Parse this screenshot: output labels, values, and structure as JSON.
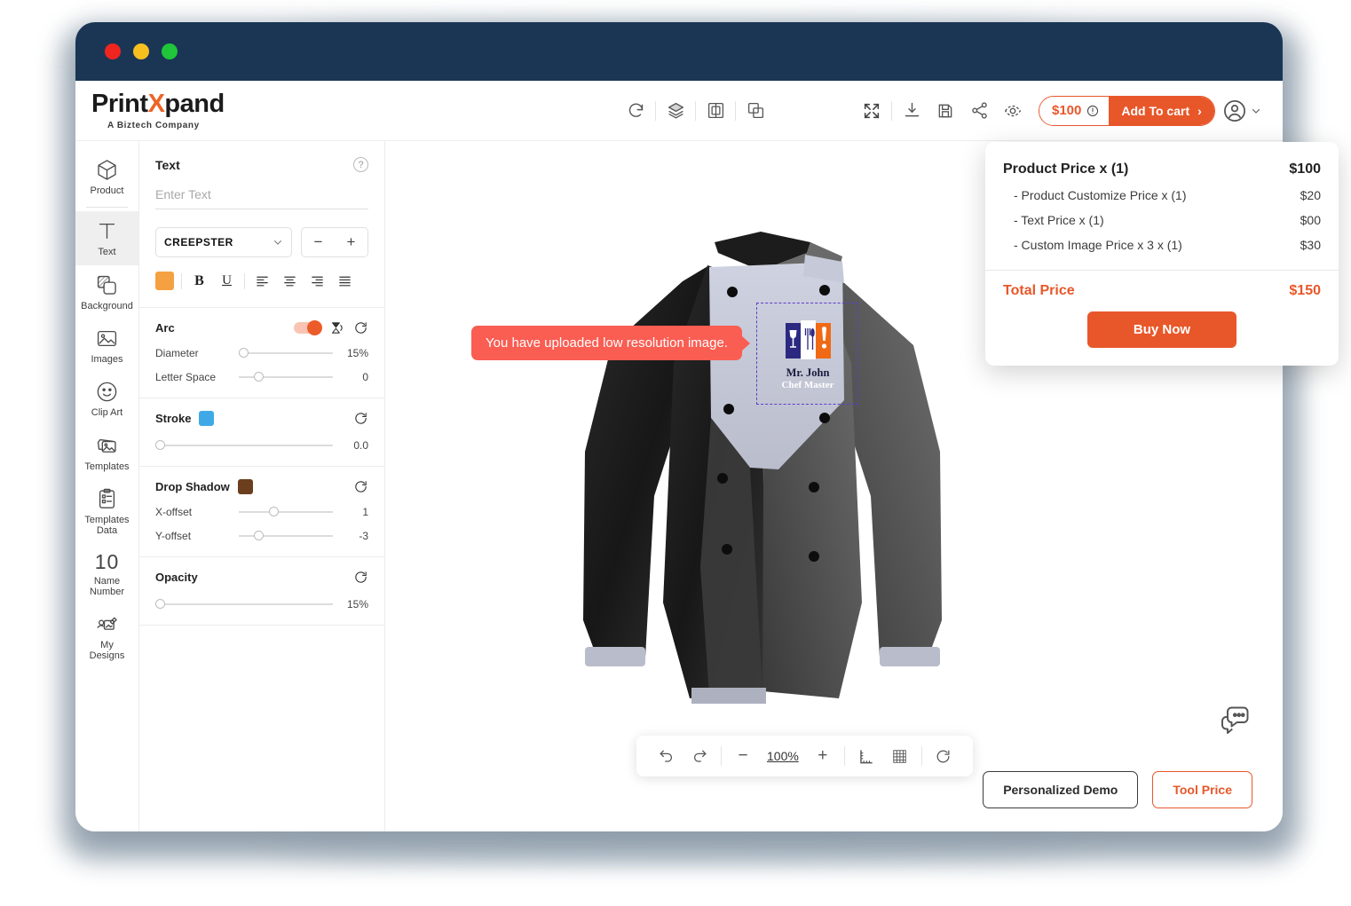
{
  "window": {
    "traffic_lights": [
      "close",
      "minimize",
      "maximize"
    ]
  },
  "brand": {
    "name_part1": "Print",
    "name_x": "X",
    "name_part2": "pand",
    "tagline": "A Biztech Company"
  },
  "toolbar": {
    "center_icons": [
      "reset-history-icon",
      "layers-icon",
      "align-objects-icon",
      "duplicate-icon"
    ],
    "right_icons": [
      "fullscreen-icon",
      "download-icon",
      "save-icon",
      "share-icon",
      "preview-eye-icon",
      "3d-view-icon"
    ],
    "price_label": "$100",
    "price_info_icon": "info-icon",
    "add_to_cart_label": "Add To cart",
    "add_to_cart_chevron": "›",
    "account_icon": "user-avatar-icon",
    "account_chevron": "chevron-down-icon"
  },
  "sidebar": {
    "items": [
      {
        "label": "Product",
        "icon": "cube-icon",
        "active": false
      },
      {
        "label": "Text",
        "icon": "text-t-icon",
        "active": true
      },
      {
        "label": "Background",
        "icon": "background-layers-icon",
        "active": false
      },
      {
        "label": "Images",
        "icon": "image-icon",
        "active": false
      },
      {
        "label": "Clip Art",
        "icon": "smiley-icon",
        "active": false
      },
      {
        "label": "Templates",
        "icon": "templates-icon",
        "active": false
      },
      {
        "label": "Templates Data",
        "label_line1": "Templates",
        "label_line2": "Data",
        "icon": "clipboard-list-icon",
        "active": false
      },
      {
        "label": "Name Number",
        "label_line1": "Name",
        "label_line2": "Number",
        "icon": "number-10-icon",
        "icon_text": "10",
        "active": false
      },
      {
        "label": "My Designs",
        "label_line1": "My",
        "label_line2": "Designs",
        "icon": "my-designs-icon",
        "active": false
      }
    ]
  },
  "panel": {
    "title": "Text",
    "help_icon": "help-question-icon",
    "text_input_placeholder": "Enter Text",
    "text_input_value": "",
    "font_name": "CREEPSTER",
    "font_dropdown_icon": "chevron-down-icon",
    "font_size_decrease": "−",
    "font_size_increase": "+",
    "color_swatch": "#f5a142",
    "bold_label": "B",
    "underline_label": "U",
    "align_icons": [
      "align-left-icon",
      "align-center-icon",
      "align-right-icon",
      "align-justify-icon"
    ],
    "arc": {
      "title": "Arc",
      "toggle_on": true,
      "flip_icon": "flip-vertical-icon",
      "reset_icon": "reset-icon",
      "diameter_label": "Diameter",
      "diameter_value": "15%",
      "diameter_pct": 15,
      "letter_space_label": "Letter Space",
      "letter_space_value": "0",
      "letter_space_pct": 23
    },
    "stroke": {
      "title": "Stroke",
      "swatch": "#3fa9e8",
      "reset_icon": "reset-icon",
      "value": "0.0",
      "pct": 0
    },
    "drop_shadow": {
      "title": "Drop Shadow",
      "swatch": "#6b3f1d",
      "reset_icon": "reset-icon",
      "x_offset_label": "X-offset",
      "x_offset_value": "1",
      "x_offset_pct": 36,
      "y_offset_label": "Y-offset",
      "y_offset_value": "-3",
      "y_offset_pct": 18
    },
    "opacity": {
      "title": "Opacity",
      "reset_icon": "reset-icon",
      "value": "15%",
      "pct": 0
    }
  },
  "canvas": {
    "product": "chef-jacket",
    "tooltip_message": "You have uploaded low resolution image.",
    "design": {
      "logo_icon": "chef-logo-icon",
      "name_line1": "Mr. John",
      "name_line2": "Chef Master"
    },
    "zoombar": {
      "undo_icon": "undo-icon",
      "redo_icon": "redo-icon",
      "zoom_out": "−",
      "zoom_level": "100%",
      "zoom_in": "+",
      "ruler_icon": "ruler-icon",
      "grid_icon": "grid-icon",
      "reset_icon": "reset-icon"
    },
    "chat_icon": "chat-bubble-icon",
    "personalized_demo_label": "Personalized Demo",
    "tool_price_label": "Tool Price"
  },
  "price_popover": {
    "rows": [
      {
        "label": "Product Price  x  (1)",
        "amount": "$100",
        "main": true
      },
      {
        "label": "- Product Customize Price  x  (1)",
        "amount": "$20",
        "main": false
      },
      {
        "label": "- Text Price x (1)",
        "amount": "$00",
        "main": false
      },
      {
        "label": "- Custom Image Price x 3 x  (1)",
        "amount": "$30",
        "main": false
      }
    ],
    "total_label": "Total Price",
    "total_amount": "$150",
    "buy_now_label": "Buy Now"
  },
  "colors": {
    "accent": "#e8572a",
    "titlebar": "#1b3655",
    "tooltip": "#fa5d52",
    "selection": "#5a3ecb"
  }
}
